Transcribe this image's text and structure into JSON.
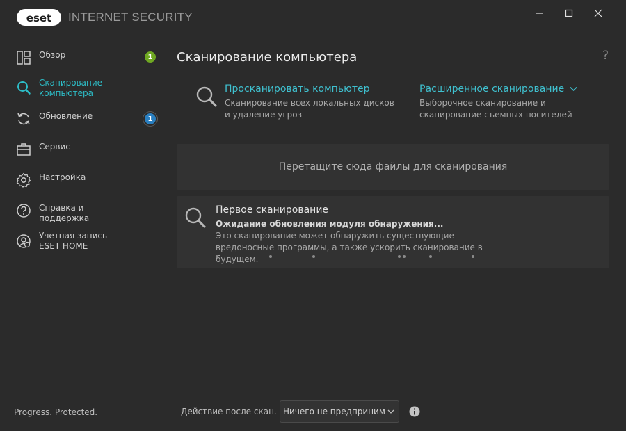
{
  "app": {
    "brand": "eset",
    "product": "INTERNET SECURITY",
    "tagline": "Progress. Protected.",
    "accent_color": "#2dbdc7"
  },
  "window_controls": {
    "minimize_icon": "minimize-icon",
    "maximize_icon": "maximize-icon",
    "close_icon": "close-icon"
  },
  "sidebar": {
    "items": [
      {
        "label": "Обзор",
        "icon": "overview-grid-icon",
        "badge": "1",
        "badge_color": "#6fa822"
      },
      {
        "label": "Сканирование компьютера",
        "icon": "search-icon",
        "active": true
      },
      {
        "label": "Обновление",
        "icon": "refresh-icon",
        "badge": "1",
        "badge_color": "#2a7fc0"
      },
      {
        "label": "Сервис",
        "icon": "briefcase-icon"
      },
      {
        "label": "Настройка",
        "icon": "gear-icon"
      },
      {
        "label": "Справка и поддержка",
        "icon": "help-icon"
      },
      {
        "label": "Учетная запись ESET HOME",
        "icon": "account-icon"
      }
    ]
  },
  "main": {
    "title": "Сканирование компьютера",
    "help": "?",
    "scan_computer": {
      "title": "Просканировать компьютер",
      "desc": "Сканирование всех локальных дисков и удаление угроз"
    },
    "advanced_scan": {
      "title": "Расширенное сканирование",
      "desc": "Выборочное сканирование и сканирование съемных носителей"
    },
    "dropzone": "Перетащите сюда файлы для сканирования",
    "first_scan": {
      "title": "Первое сканирование",
      "status": "Ожидание обновления модуля обнаружения...",
      "desc": "Это сканирование может обнаружить существующие вредоносные программы, а также ускорить сканирование в будущем."
    }
  },
  "footer": {
    "action_label": "Действие после скан.",
    "action_value": "Ничего не предприним...",
    "info_icon": "info-icon"
  }
}
